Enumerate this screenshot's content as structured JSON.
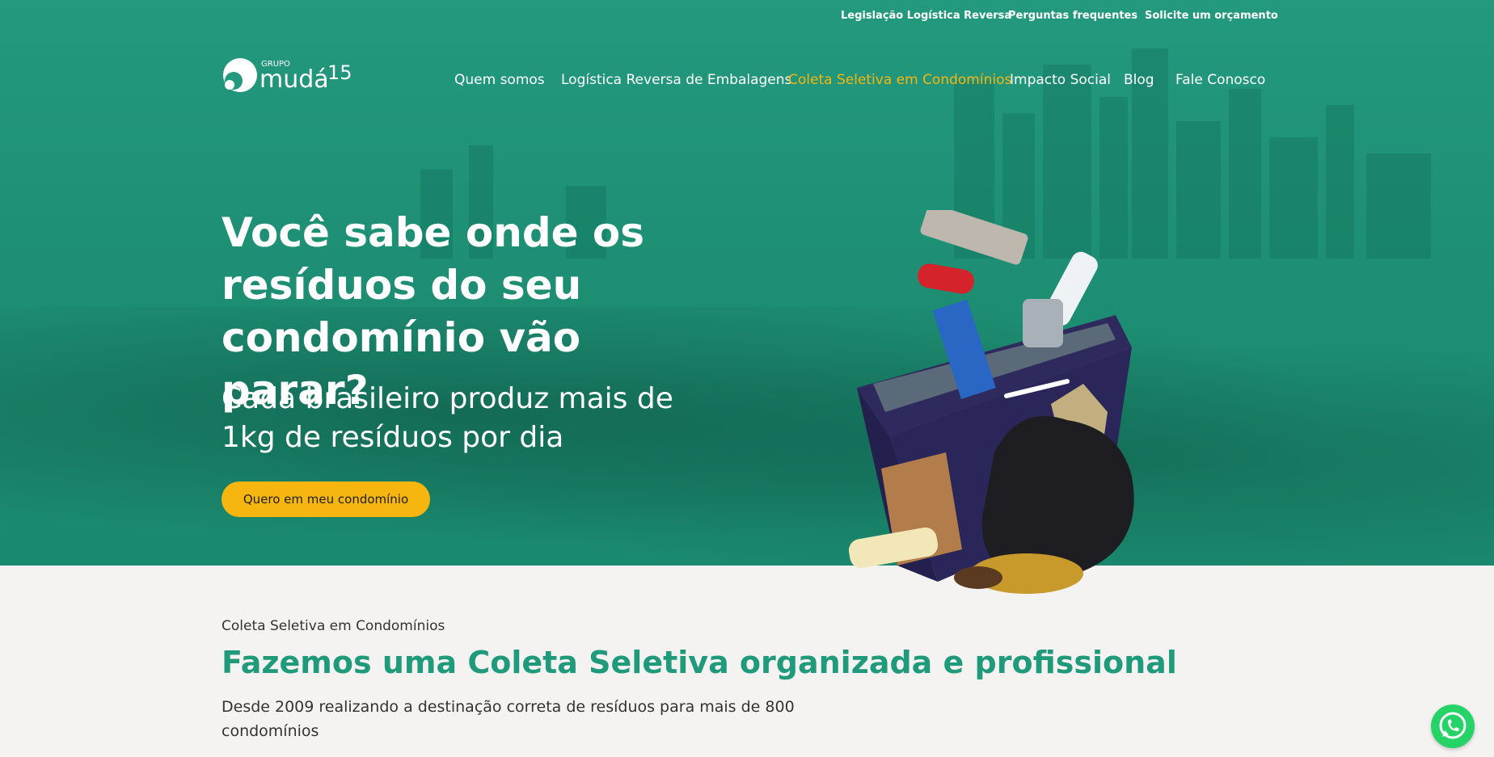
{
  "topbar": {
    "links": [
      "Legislação Logística Reversa",
      "Perguntas frequentes",
      "Solicite um orçamento"
    ]
  },
  "logo": {
    "small_text": "GRUPO",
    "name": "mudá",
    "anniversary": "15"
  },
  "nav": {
    "items": [
      "Quem somos",
      "Logística Reversa de Embalagens",
      "Coleta Seletiva em Condomínios",
      "Impacto Social",
      "Blog",
      "Fale Conosco"
    ],
    "active": "Coleta Seletiva em Condomínios"
  },
  "hero": {
    "headline": "Você sabe onde os resíduos do seu condomínio vão parar?",
    "subheadline": "Cada brasileiro produz mais de 1kg de resíduos por dia",
    "cta": "Quero em meu condomínio"
  },
  "section": {
    "breadcrumb": "Coleta Seletiva em Condomínios",
    "title": "Fazemos uma Coleta Seletiva organizada e profissional",
    "text": "Desde 2009 realizando a destinação correta de resíduos para mais de 800 condomínios"
  },
  "colors": {
    "hero_green": "#23997d",
    "accent_yellow": "#f6b60f",
    "title_green": "#1f9a7b",
    "whatsapp": "#25d366"
  },
  "icons": {
    "whatsapp": "whatsapp-icon"
  }
}
